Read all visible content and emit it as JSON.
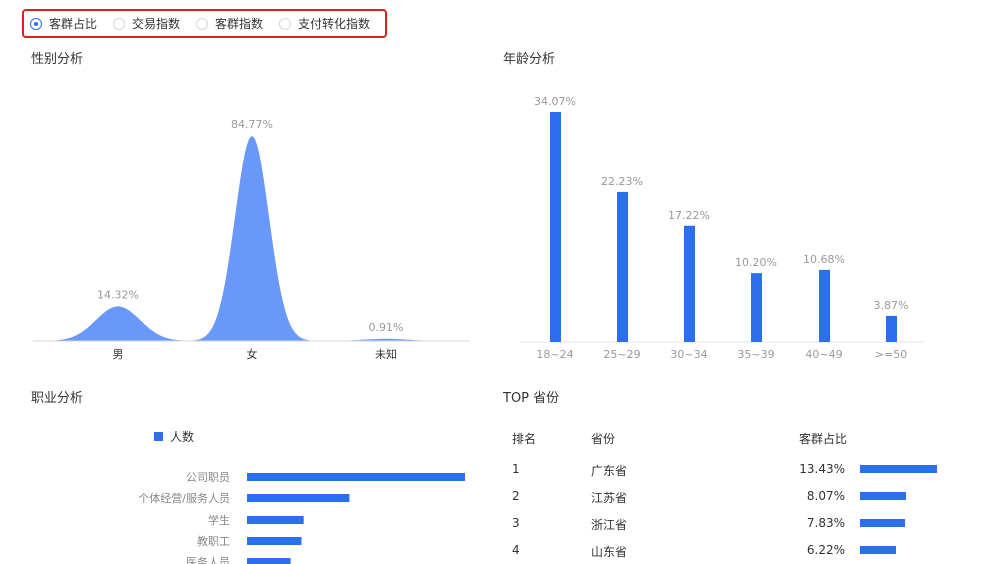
{
  "radio_tabs": [
    {
      "label": "客群占比",
      "selected": true
    },
    {
      "label": "交易指数",
      "selected": false
    },
    {
      "label": "客群指数",
      "selected": false
    },
    {
      "label": "支付转化指数",
      "selected": false
    }
  ],
  "gender": {
    "title": "性别分析",
    "chart_data": {
      "type": "area",
      "categories": [
        "男",
        "女",
        "未知"
      ],
      "values": [
        14.32,
        84.77,
        0.91
      ],
      "data_labels": [
        "14.32%",
        "84.77%",
        "0.91%"
      ],
      "color": "#5b8ff9"
    }
  },
  "age": {
    "title": "年龄分析",
    "chart_data": {
      "type": "bar",
      "categories": [
        "18~24",
        "25~29",
        "30~34",
        "35~39",
        "40~49",
        ">=50"
      ],
      "values": [
        34.07,
        22.23,
        17.22,
        10.2,
        10.68,
        3.87
      ],
      "data_labels": [
        "34.07%",
        "22.23%",
        "17.22%",
        "10.20%",
        "10.68%",
        "3.87%"
      ],
      "color": "#2b6fea"
    }
  },
  "occupation": {
    "title": "职业分析",
    "legend": "人数",
    "chart_data": {
      "type": "bar",
      "orientation": "horizontal",
      "series": [
        {
          "name": "人数",
          "values": [
            100,
            47,
            26,
            25,
            20
          ]
        }
      ],
      "categories": [
        "公司职员",
        "个体经营/服务人员",
        "学生",
        "教职工",
        "医务人员"
      ],
      "color": "#2b6fea"
    }
  },
  "province": {
    "title": "TOP 省份",
    "headers": {
      "rank": "排名",
      "province": "省份",
      "share": "客群占比"
    },
    "rows": [
      {
        "rank": "1",
        "province": "广东省",
        "share": "13.43%",
        "value": 13.43
      },
      {
        "rank": "2",
        "province": "江苏省",
        "share": "8.07%",
        "value": 8.07
      },
      {
        "rank": "3",
        "province": "浙江省",
        "share": "7.83%",
        "value": 7.83
      },
      {
        "rank": "4",
        "province": "山东省",
        "share": "6.22%",
        "value": 6.22
      }
    ],
    "bar_color": "#2b6fea"
  }
}
